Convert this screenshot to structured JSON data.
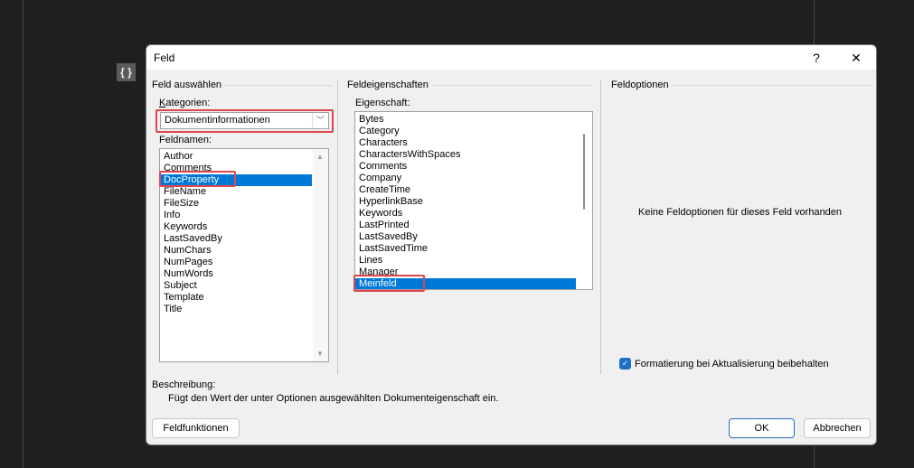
{
  "editor": {
    "field_code_marker": "{ }"
  },
  "dialog": {
    "title": "Feld",
    "help_label": "?",
    "close_label": "✕",
    "select_group": {
      "label": "Feld auswählen",
      "categories_label": "Kategorien:",
      "categories_value": "Dokumentinformationen",
      "fieldnames_label": "Feldnamen:",
      "fieldnames": [
        "Author",
        "Comments",
        "DocProperty",
        "FileName",
        "FileSize",
        "Info",
        "Keywords",
        "LastSavedBy",
        "NumChars",
        "NumPages",
        "NumWords",
        "Subject",
        "Template",
        "Title"
      ],
      "selected_fieldname": "DocProperty"
    },
    "properties_group": {
      "label": "Feldeigenschaften",
      "property_label": "Eigenschaft:",
      "properties": [
        "Bytes",
        "Category",
        "Characters",
        "CharactersWithSpaces",
        "Comments",
        "Company",
        "CreateTime",
        "HyperlinkBase",
        "Keywords",
        "LastPrinted",
        "LastSavedBy",
        "LastSavedTime",
        "Lines",
        "Manager",
        "Meinfeld"
      ],
      "selected_property": "Meinfeld"
    },
    "options_group": {
      "label": "Feldoptionen",
      "empty_text": "Keine Feldoptionen für dieses Feld vorhanden",
      "preserve_format_label": "Formatierung bei Aktualisierung beibehalten",
      "preserve_format_checked": true
    },
    "description": {
      "label": "Beschreibung:",
      "text": "Fügt den Wert der unter Optionen ausgewählten Dokumenteigenschaft ein."
    },
    "buttons": {
      "field_codes": "Feldfunktionen",
      "ok": "OK",
      "cancel": "Abbrechen"
    },
    "colors": {
      "selection": "#0078d7",
      "highlight_box": "#e0474c"
    }
  }
}
